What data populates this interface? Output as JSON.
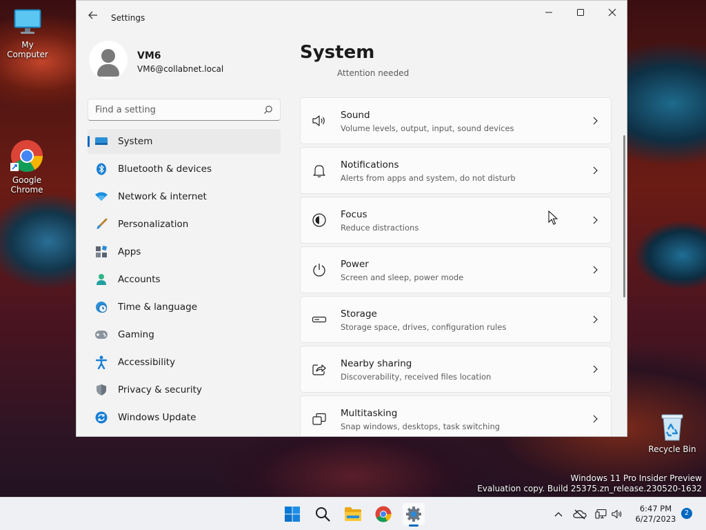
{
  "desktop": {
    "icons": [
      {
        "label": "My Computer",
        "icon": "monitor-icon"
      },
      {
        "label": "Google Chrome",
        "icon": "chrome-icon"
      },
      {
        "label": "Recycle Bin",
        "icon": "recycle-bin-icon"
      }
    ],
    "watermark_line1": "Windows 11 Pro Insider Preview",
    "watermark_line2": "Evaluation copy. Build 25375.zn_release.230520-1632"
  },
  "window": {
    "title": "Settings",
    "controls": {
      "minimize": "minimize-icon",
      "maximize": "maximize-icon",
      "close": "close-icon"
    }
  },
  "profile": {
    "name": "VM6",
    "email": "VM6@collabnet.local"
  },
  "search": {
    "placeholder": "Find a setting",
    "value": ""
  },
  "nav": {
    "selected": "System",
    "items": [
      {
        "label": "System",
        "icon": "system-display-icon"
      },
      {
        "label": "Bluetooth & devices",
        "icon": "bluetooth-icon"
      },
      {
        "label": "Network & internet",
        "icon": "wifi-icon"
      },
      {
        "label": "Personalization",
        "icon": "brush-icon"
      },
      {
        "label": "Apps",
        "icon": "apps-icon"
      },
      {
        "label": "Accounts",
        "icon": "account-icon"
      },
      {
        "label": "Time & language",
        "icon": "globe-clock-icon"
      },
      {
        "label": "Gaming",
        "icon": "gamepad-icon"
      },
      {
        "label": "Accessibility",
        "icon": "accessibility-icon"
      },
      {
        "label": "Privacy & security",
        "icon": "shield-icon"
      },
      {
        "label": "Windows Update",
        "icon": "update-icon"
      }
    ]
  },
  "main": {
    "title": "System",
    "partial_text": "Attention needed",
    "cards": [
      {
        "title": "Sound",
        "subtitle": "Volume levels, output, input, sound devices",
        "icon": "speaker-icon"
      },
      {
        "title": "Notifications",
        "subtitle": "Alerts from apps and system, do not disturb",
        "icon": "bell-icon"
      },
      {
        "title": "Focus",
        "subtitle": "Reduce distractions",
        "icon": "focus-icon"
      },
      {
        "title": "Power",
        "subtitle": "Screen and sleep, power mode",
        "icon": "power-icon"
      },
      {
        "title": "Storage",
        "subtitle": "Storage space, drives, configuration rules",
        "icon": "storage-icon"
      },
      {
        "title": "Nearby sharing",
        "subtitle": "Discoverability, received files location",
        "icon": "share-icon"
      },
      {
        "title": "Multitasking",
        "subtitle": "Snap windows, desktops, task switching",
        "icon": "multitasking-icon"
      }
    ]
  },
  "taskbar": {
    "apps": [
      {
        "name": "Start",
        "icon": "windows-start-icon"
      },
      {
        "name": "Search",
        "icon": "search-icon"
      },
      {
        "name": "File Explorer",
        "icon": "folder-icon"
      },
      {
        "name": "Google Chrome",
        "icon": "chrome-icon"
      },
      {
        "name": "Settings",
        "icon": "gear-icon",
        "active": true
      }
    ],
    "tray": {
      "icons": [
        "chevron-up-icon",
        "onedrive-offline-icon",
        "network-icon",
        "volume-icon"
      ],
      "time": "6:47 PM",
      "date": "6/27/2023",
      "notification_count": "2"
    }
  },
  "colors": {
    "accent": "#0067c0",
    "window_bg": "#f3f3f3",
    "card_bg": "#fbfbfb"
  }
}
